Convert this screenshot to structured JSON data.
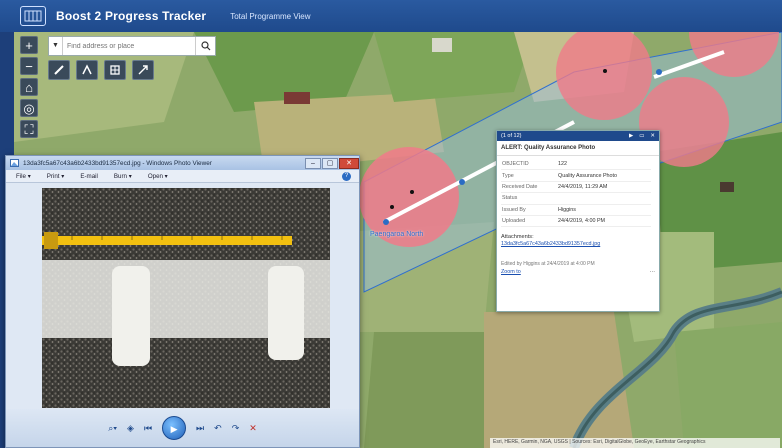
{
  "header": {
    "title": "Boost 2 Progress Tracker",
    "subtitle": "Total Programme View"
  },
  "map": {
    "controls": [
      "+",
      "−",
      "home",
      "locate",
      "fullscreen"
    ],
    "search": {
      "placeholder": "Find address or place"
    },
    "area_label": "Paengaroa North",
    "attribution": "Esri, HERE, Garmin, NGA, USGS | Sources: Esri, DigitalGlobe, GeoEye, Earthstar Geographics"
  },
  "popup": {
    "counter": "(1 of 12)",
    "title": "ALERT: Quality Assurance Photo",
    "fields": [
      {
        "key": "OBJECTID",
        "value": "122"
      },
      {
        "key": "Type",
        "value": "Quality Assurance Photo"
      },
      {
        "key": "Received Date",
        "value": "24/4/2019, 11:29 AM"
      },
      {
        "key": "Status",
        "value": ""
      },
      {
        "key": "Issued By",
        "value": "Higgins"
      },
      {
        "key": "Uploaded",
        "value": "24/4/2019, 4:00 PM"
      }
    ],
    "attachments_label": "Attachments:",
    "attachment_file": "13da3fc5a67c43a6b2433bd91357ecd.jpg",
    "edited_by": "Edited by Higgins at 24/4/2019 at 4:00 PM",
    "zoom_label": "Zoom to",
    "more_label": "···"
  },
  "viewer": {
    "title": "13da3fc5a67c43a6b2433bd91357ecd.jpg - Windows Photo Viewer",
    "menu": [
      "File ▾",
      "Print ▾",
      "E-mail",
      "Burn ▾",
      "Open ▾"
    ],
    "help": "?",
    "controls": [
      "⌕▾",
      "◈",
      "⏮",
      "▶",
      "⏭",
      "↶",
      "↷",
      "✕"
    ]
  },
  "colors": {
    "header": "#1f4a8c",
    "buffer": "#f07a8a",
    "route": "#3d7dd8"
  }
}
